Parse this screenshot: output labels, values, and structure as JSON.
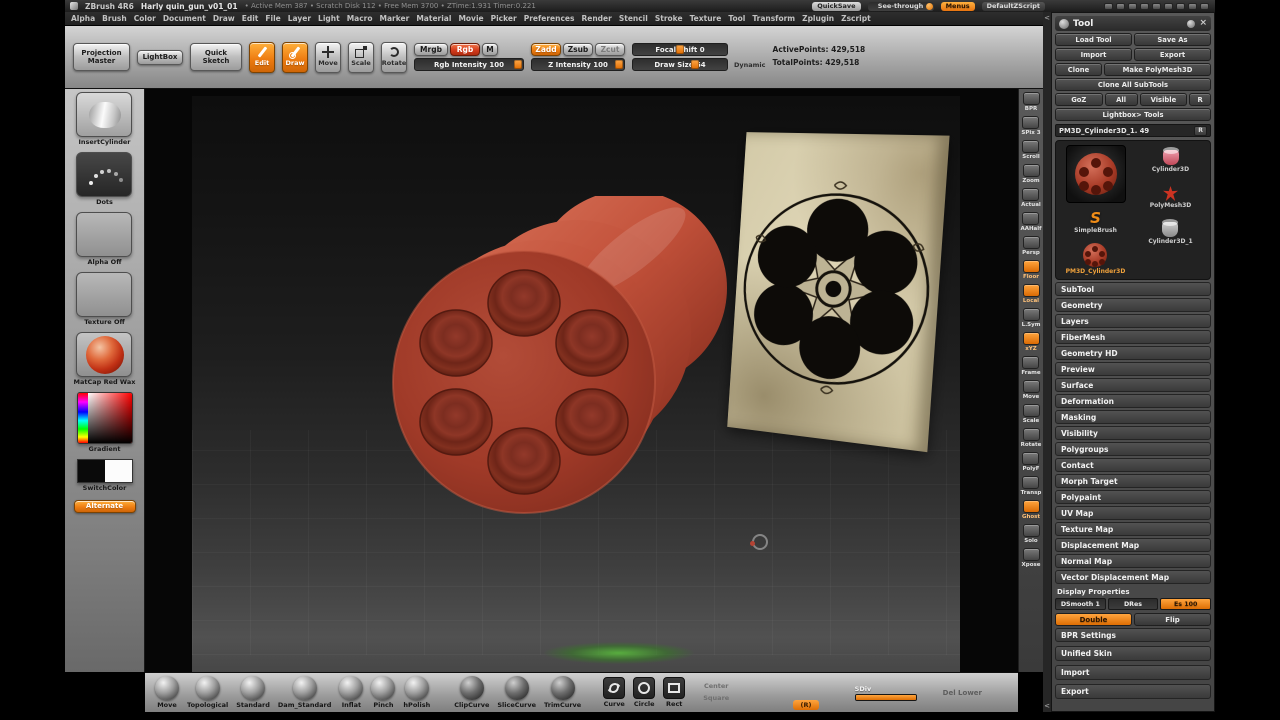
{
  "title_bar": {
    "app_name": "ZBrush 4R6",
    "doc_name": "Harly quin_gun_v01_01",
    "stats": "• Active Mem 387 • Scratch Disk 112 • Free Mem 3700 • ZTime:1.931 Timer:0.221",
    "quicksave_label": "QuickSave",
    "see_through_label": "See-through",
    "menus_label": "Menus",
    "zscript_label": "DefaultZScript",
    "icons": [
      {
        "name": "interface-icon-1"
      },
      {
        "name": "interface-icon-2"
      },
      {
        "name": "interface-icon-3"
      },
      {
        "name": "interface-icon-4"
      },
      {
        "name": "interface-icon-5"
      },
      {
        "name": "interface-icon-6"
      },
      {
        "name": "interface-icon-7"
      },
      {
        "name": "interface-icon-8"
      },
      {
        "name": "interface-icon-9"
      }
    ]
  },
  "menu_bar": {
    "items": [
      "Alpha",
      "Brush",
      "Color",
      "Document",
      "Draw",
      "Edit",
      "File",
      "Layer",
      "Light",
      "Macro",
      "Marker",
      "Material",
      "Movie",
      "Picker",
      "Preferences",
      "Render",
      "Stencil",
      "Stroke",
      "Texture",
      "Tool",
      "Transform",
      "Zplugin",
      "Zscript"
    ]
  },
  "top_shelf": {
    "projection_master": "Projection Master",
    "lightbox": "LightBox",
    "quick_sketch": "Quick Sketch",
    "edit": "Edit",
    "draw": "Draw",
    "move": "Move",
    "scale": "Scale",
    "rotate": "Rotate",
    "mrgb": "Mrgb",
    "rgb": "Rgb",
    "m": "M",
    "rgb_intensity": "Rgb Intensity 100",
    "zadd": "Zadd",
    "zsub": "Zsub",
    "zcut": "Zcut",
    "z_intensity": "Z Intensity 100",
    "focal_shift": "Focal Shift 0",
    "draw_size": "Draw Size 64",
    "dynamic": "Dynamic",
    "active_points": "ActivePoints: 429,518",
    "total_points": "TotalPoints: 429,518"
  },
  "left_shelf": {
    "items": [
      {
        "name": "current-brush",
        "label": "InsertCylinder",
        "cls": "thumb-brush"
      },
      {
        "name": "stroke-selector",
        "label": "Dots",
        "cls": "thumb-dots"
      },
      {
        "name": "alpha-selector",
        "label": "Alpha Off",
        "cls": "thumb-empty"
      },
      {
        "name": "texture-selector",
        "label": "Texture Off",
        "cls": "thumb-empty"
      },
      {
        "name": "material-selector",
        "label": "MatCap Red Wax",
        "cls": "thumb-matcap"
      }
    ],
    "gradient_label": "Gradient",
    "switch_label": "SwitchColor",
    "alternate_label": "Alternate"
  },
  "right_shelf": {
    "items": [
      {
        "name": "bpr-button",
        "label": "BPR"
      },
      {
        "name": "spix-slider",
        "label": "SPix 3"
      },
      {
        "name": "scroll-button",
        "label": "Scroll"
      },
      {
        "name": "zoom-button",
        "label": "Zoom"
      },
      {
        "name": "actual-button",
        "label": "Actual"
      },
      {
        "name": "aahalf-button",
        "label": "AAHalf"
      },
      {
        "name": "persp-toggle",
        "label": "Persp"
      },
      {
        "name": "floor-toggle",
        "label": "Floor",
        "cls": "active"
      },
      {
        "name": "local-toggle",
        "label": "Local",
        "cls": "active"
      },
      {
        "name": "lsym-toggle",
        "label": "L.Sym"
      },
      {
        "name": "xyz-toggle",
        "label": "xYZ",
        "cls": "active"
      },
      {
        "name": "frame-button",
        "label": "Frame"
      },
      {
        "name": "move-gizmo-button",
        "label": "Move"
      },
      {
        "name": "scale-gizmo-button",
        "label": "Scale"
      },
      {
        "name": "rotate-gizmo-button",
        "label": "Rotate"
      },
      {
        "name": "polyf-toggle",
        "label": "PolyF"
      },
      {
        "name": "transp-toggle",
        "label": "Transp"
      },
      {
        "name": "ghost-toggle",
        "label": "Ghost",
        "cls": "active"
      },
      {
        "name": "solo-toggle",
        "label": "Solo"
      },
      {
        "name": "xpose-button",
        "label": "Xpose"
      }
    ]
  },
  "tool_panel": {
    "title": "Tool",
    "buttons": {
      "load_tool": "Load Tool",
      "save_as": "Save As",
      "import": "Import",
      "export": "Export",
      "clone": "Clone",
      "make_polymesh": "Make PolyMesh3D",
      "clone_all": "Clone All SubTools",
      "goz": "GoZ",
      "all": "All",
      "visible": "Visible",
      "r": "R",
      "lightbox_tools": "Lightbox> Tools"
    },
    "active_tool": {
      "name": "PM3D_Cylinder3D_1. 49",
      "r": "R"
    },
    "tools": {
      "cylinder3d": "Cylinder3D",
      "polymesh3d": "PolyMesh3D",
      "simplebrush": "SimpleBrush",
      "cylinder3d_1": "Cylinder3D_1",
      "pm3d": "PM3D_Cylinder3D"
    },
    "sections": [
      "SubTool",
      "Geometry",
      "Layers",
      "FiberMesh",
      "Geometry HD",
      "Preview",
      "Surface",
      "Deformation",
      "Masking",
      "Visibility",
      "Polygroups",
      "Contact",
      "Morph Target",
      "Polypaint",
      "UV Map",
      "Texture Map",
      "Displacement Map",
      "Normal Map",
      "Vector Displacement Map"
    ],
    "display_properties": {
      "title": "Display Properties",
      "dsmooth": "DSmooth 1",
      "dres": "DRes",
      "es": "Es 100",
      "double": "Double",
      "flip": "Flip",
      "bpr_settings": "BPR Settings"
    },
    "sections_bottom": [
      "Unified Skin",
      "Import",
      "Export"
    ]
  },
  "bottom_shelf": {
    "brushes": [
      {
        "name": "brush-move",
        "label": "Move"
      },
      {
        "name": "brush-topological",
        "label": "Topological"
      },
      {
        "name": "brush-standard",
        "label": "Standard"
      },
      {
        "name": "brush-dam-standard",
        "label": "Dam_Standard"
      },
      {
        "name": "brush-inflat",
        "label": "Inflat"
      },
      {
        "name": "brush-pinch",
        "label": "Pinch"
      },
      {
        "name": "brush-hpolish",
        "label": "hPolish"
      }
    ],
    "curve_brushes": [
      {
        "name": "brush-clipcurve",
        "label": "ClipCurve",
        "cls": "dark"
      },
      {
        "name": "brush-slicecurve",
        "label": "SliceCurve",
        "cls": "dark"
      },
      {
        "name": "brush-trimcurve",
        "label": "TrimCurve",
        "cls": "dark"
      }
    ],
    "strokes": [
      {
        "name": "stroke-curve",
        "label": "Curve",
        "cls": "st-curve"
      },
      {
        "name": "stroke-circle",
        "label": "Circle",
        "cls": "st-circle"
      },
      {
        "name": "stroke-rect",
        "label": "Rect",
        "cls": "st-rect"
      }
    ],
    "center_label": "Center",
    "square_label": "Square",
    "r_button": "(R)",
    "sdiv_label": "SDiv",
    "del_lower": "Del Lower"
  }
}
